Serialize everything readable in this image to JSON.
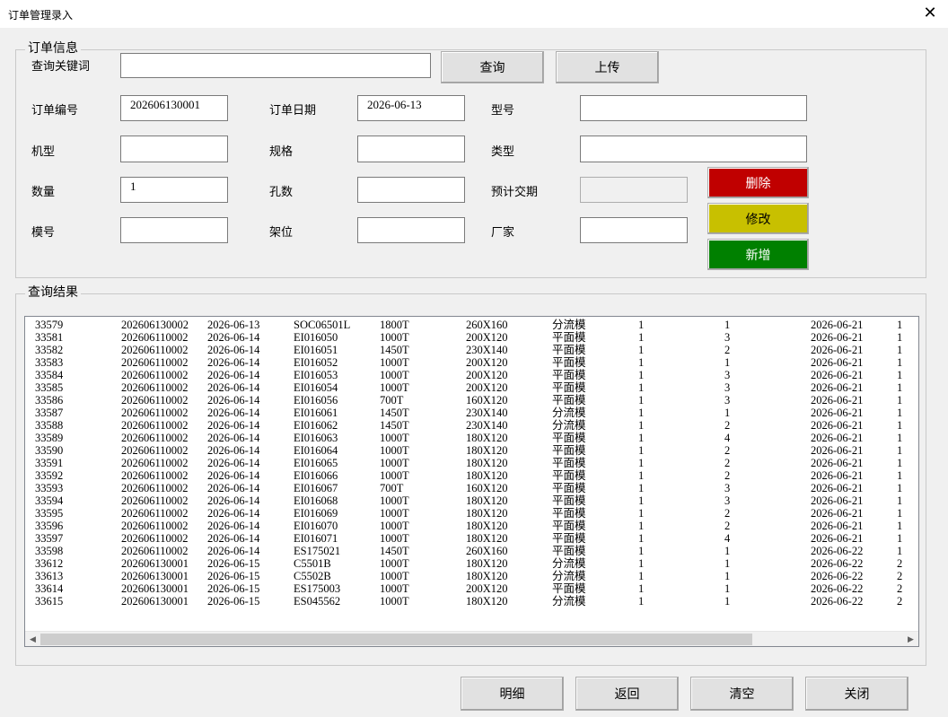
{
  "window": {
    "title": "订单管理录入",
    "close": "✕"
  },
  "order_group": {
    "title": "订单信息",
    "search_label": "查询关键词",
    "search_value": "",
    "query_button": "查询",
    "upload_button": "上传",
    "labels": {
      "order_no": "订单编号",
      "order_date": "订单日期",
      "model_no": "型号",
      "machine": "机型",
      "spec": "规格",
      "type": "类型",
      "quantity": "数量",
      "holes": "孔数",
      "delivery": "预计交期",
      "mold_no": "模号",
      "rack": "架位",
      "vendor": "厂家"
    },
    "values": {
      "order_no": "202606130001",
      "order_date": "2026-06-13",
      "model_no": "",
      "machine": "",
      "spec": "",
      "type": "",
      "quantity": "1",
      "holes": "",
      "delivery": "",
      "mold_no": "",
      "rack": "",
      "vendor": ""
    },
    "delete_button": "删除",
    "edit_button": "修改",
    "add_button": "新增"
  },
  "results_group": {
    "title": "查询结果",
    "rows": [
      [
        "33579",
        "202606130002",
        "2026-06-13",
        "SOC06501L",
        "1800T",
        "260X160",
        "分流模",
        "1",
        "1",
        "2026-06-21",
        "1"
      ],
      [
        "33581",
        "202606110002",
        "2026-06-14",
        "EI016050",
        "1000T",
        "200X120",
        "平面模",
        "1",
        "3",
        "2026-06-21",
        "1"
      ],
      [
        "33582",
        "202606110002",
        "2026-06-14",
        "EI016051",
        "1450T",
        "230X140",
        "平面模",
        "1",
        "2",
        "2026-06-21",
        "1"
      ],
      [
        "33583",
        "202606110002",
        "2026-06-14",
        "EI016052",
        "1000T",
        "200X120",
        "平面模",
        "1",
        "1",
        "2026-06-21",
        "1"
      ],
      [
        "33584",
        "202606110002",
        "2026-06-14",
        "EI016053",
        "1000T",
        "200X120",
        "平面模",
        "1",
        "3",
        "2026-06-21",
        "1"
      ],
      [
        "33585",
        "202606110002",
        "2026-06-14",
        "EI016054",
        "1000T",
        "200X120",
        "平面模",
        "1",
        "3",
        "2026-06-21",
        "1"
      ],
      [
        "33586",
        "202606110002",
        "2026-06-14",
        "EI016056",
        "700T",
        "160X120",
        "平面模",
        "1",
        "3",
        "2026-06-21",
        "1"
      ],
      [
        "33587",
        "202606110002",
        "2026-06-14",
        "EI016061",
        "1450T",
        "230X140",
        "分流模",
        "1",
        "1",
        "2026-06-21",
        "1"
      ],
      [
        "33588",
        "202606110002",
        "2026-06-14",
        "EI016062",
        "1450T",
        "230X140",
        "分流模",
        "1",
        "2",
        "2026-06-21",
        "1"
      ],
      [
        "33589",
        "202606110002",
        "2026-06-14",
        "EI016063",
        "1000T",
        "180X120",
        "平面模",
        "1",
        "4",
        "2026-06-21",
        "1"
      ],
      [
        "33590",
        "202606110002",
        "2026-06-14",
        "EI016064",
        "1000T",
        "180X120",
        "平面模",
        "1",
        "2",
        "2026-06-21",
        "1"
      ],
      [
        "33591",
        "202606110002",
        "2026-06-14",
        "EI016065",
        "1000T",
        "180X120",
        "平面模",
        "1",
        "2",
        "2026-06-21",
        "1"
      ],
      [
        "33592",
        "202606110002",
        "2026-06-14",
        "EI016066",
        "1000T",
        "180X120",
        "平面模",
        "1",
        "2",
        "2026-06-21",
        "1"
      ],
      [
        "33593",
        "202606110002",
        "2026-06-14",
        "EI016067",
        "700T",
        "160X120",
        "平面模",
        "1",
        "3",
        "2026-06-21",
        "1"
      ],
      [
        "33594",
        "202606110002",
        "2026-06-14",
        "EI016068",
        "1000T",
        "180X120",
        "平面模",
        "1",
        "3",
        "2026-06-21",
        "1"
      ],
      [
        "33595",
        "202606110002",
        "2026-06-14",
        "EI016069",
        "1000T",
        "180X120",
        "平面模",
        "1",
        "2",
        "2026-06-21",
        "1"
      ],
      [
        "33596",
        "202606110002",
        "2026-06-14",
        "EI016070",
        "1000T",
        "180X120",
        "平面模",
        "1",
        "2",
        "2026-06-21",
        "1"
      ],
      [
        "33597",
        "202606110002",
        "2026-06-14",
        "EI016071",
        "1000T",
        "180X120",
        "平面模",
        "1",
        "4",
        "2026-06-21",
        "1"
      ],
      [
        "33598",
        "202606110002",
        "2026-06-14",
        "ES175021",
        "1450T",
        "260X160",
        "平面模",
        "1",
        "1",
        "2026-06-22",
        "1"
      ],
      [
        "33612",
        "202606130001",
        "2026-06-15",
        "C5501B",
        "1000T",
        "180X120",
        "分流模",
        "1",
        "1",
        "2026-06-22",
        "2"
      ],
      [
        "33613",
        "202606130001",
        "2026-06-15",
        "C5502B",
        "1000T",
        "180X120",
        "分流模",
        "1",
        "1",
        "2026-06-22",
        "2"
      ],
      [
        "33614",
        "202606130001",
        "2026-06-15",
        "ES175003",
        "1000T",
        "200X120",
        "平面模",
        "1",
        "1",
        "2026-06-22",
        "2"
      ],
      [
        "33615",
        "202606130001",
        "2026-06-15",
        "ES045562",
        "1000T",
        "180X120",
        "分流模",
        "1",
        "1",
        "2026-06-22",
        "2"
      ]
    ],
    "scroll_left": "◀",
    "scroll_right": "▶"
  },
  "footer": {
    "detail_button": "明细",
    "back_button": "返回",
    "clear_button": "清空",
    "close_button": "关闭"
  }
}
